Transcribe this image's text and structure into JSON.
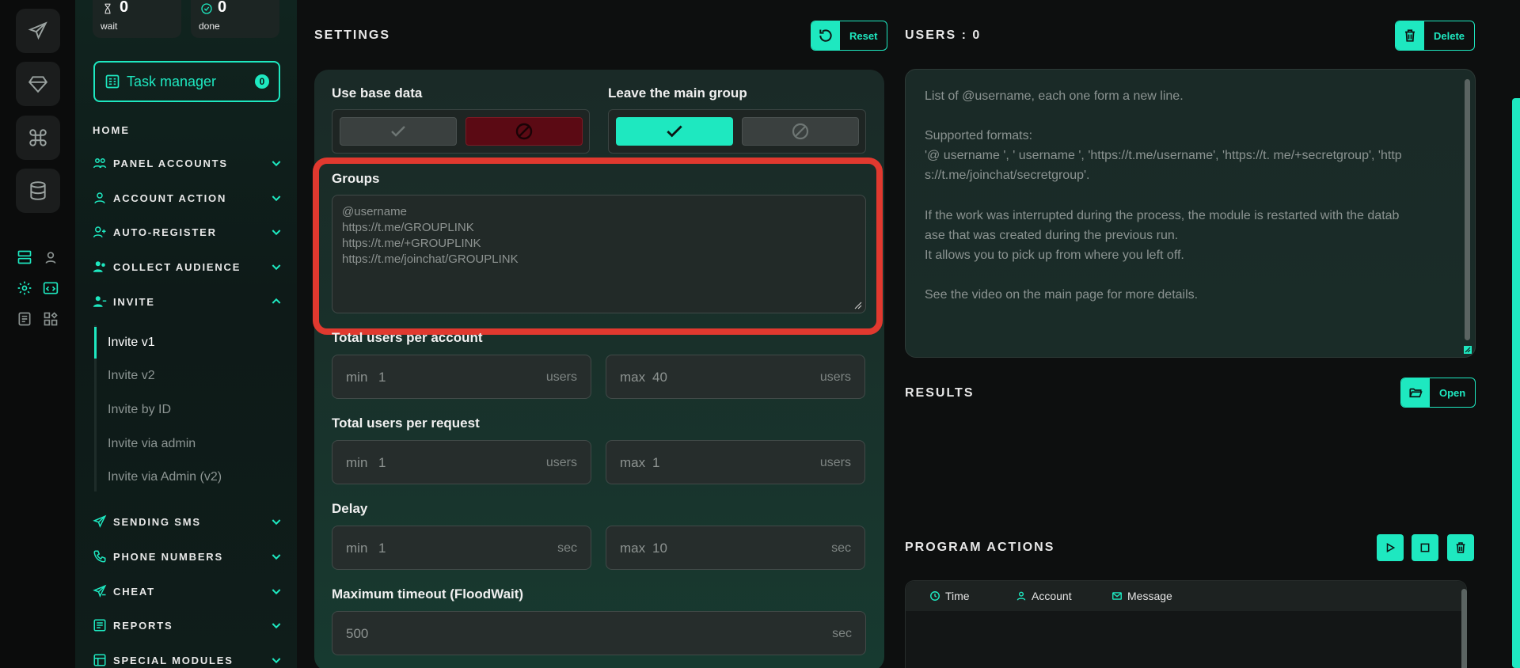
{
  "stats": [
    {
      "value": "0",
      "label": "wait",
      "icon": "hourglass-icon"
    },
    {
      "value": "0",
      "label": "done",
      "icon": "check-circle-icon"
    }
  ],
  "task_manager": {
    "label": "Task manager",
    "badge": "0"
  },
  "nav": {
    "home": "HOME",
    "items": [
      {
        "label": "PANEL ACCOUNTS",
        "icon": "users-icon",
        "expanded": false
      },
      {
        "label": "ACCOUNT ACTION",
        "icon": "user-icon",
        "expanded": false
      },
      {
        "label": "AUTO-REGISTER",
        "icon": "user-plus-icon",
        "expanded": false
      },
      {
        "label": "COLLECT AUDIENCE",
        "icon": "user-group-icon",
        "expanded": false
      },
      {
        "label": "INVITE",
        "icon": "user-invite-icon",
        "expanded": true
      },
      {
        "label": "SENDING SMS",
        "icon": "send-icon",
        "expanded": false
      },
      {
        "label": "PHONE NUMBERS",
        "icon": "phone-icon",
        "expanded": false
      },
      {
        "label": "CHEAT",
        "icon": "send-cheat-icon",
        "expanded": false
      },
      {
        "label": "REPORTS",
        "icon": "report-icon",
        "expanded": false
      },
      {
        "label": "SPECIAL MODULES",
        "icon": "modules-icon",
        "expanded": false
      }
    ],
    "invite_sub": [
      "Invite v1",
      "Invite v2",
      "Invite by ID",
      "Invite via admin",
      "Invite via Admin (v2)"
    ],
    "invite_active": "Invite v1"
  },
  "settings": {
    "title": "SETTINGS",
    "reset_label": "Reset",
    "use_base_data": {
      "label": "Use base data",
      "value": "off"
    },
    "leave_main_group": {
      "label": "Leave the main group",
      "value": "on"
    },
    "groups": {
      "label": "Groups",
      "placeholder_lines": [
        "@username",
        "https://t.me/GROUPLINK",
        "https://t.me/+GROUPLINK",
        "https://t.me/joinchat/GROUPLINK"
      ]
    },
    "total_users_per_account": {
      "label": "Total users per account",
      "min": "1",
      "max": "40",
      "unit": "users"
    },
    "total_users_per_request": {
      "label": "Total users per request",
      "min": "1",
      "max": "1",
      "unit": "users"
    },
    "delay": {
      "label": "Delay",
      "min": "1",
      "max": "10",
      "unit": "sec"
    },
    "max_timeout": {
      "label": "Maximum timeout (FloodWait)",
      "value": "500",
      "unit": "sec"
    },
    "min_label": "min",
    "max_label": "max"
  },
  "users": {
    "title": "USERS : 0",
    "delete_label": "Delete",
    "placeholder_lines": [
      "List of @username, each one form a new line.",
      "",
      "Supported formats:",
      "'@ username ', ' username ', 'https://t.me/username', 'https://t. me/+secretgroup', 'http",
      "s://t.me/joinchat/secretgroup'.",
      "",
      "If the work was interrupted during the process, the module is restarted with the datab",
      "ase that was created during the previous run.",
      "It allows you to pick up from where you left off.",
      "",
      "See the video on the main page for more details."
    ]
  },
  "results": {
    "title": "RESULTS",
    "open_label": "Open"
  },
  "program_actions": {
    "title": "PROGRAM ACTIONS",
    "columns": [
      {
        "label": "Time",
        "icon": "clock-icon"
      },
      {
        "label": "Account",
        "icon": "user-icon"
      },
      {
        "label": "Message",
        "icon": "mail-icon"
      }
    ]
  },
  "colors": {
    "accent": "#1ee8c0",
    "highlight": "#e0392f",
    "danger": "#5b0a14"
  }
}
